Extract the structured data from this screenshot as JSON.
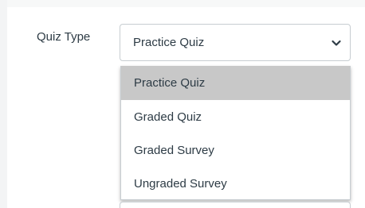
{
  "form": {
    "quiz_type_label": "Quiz Type",
    "quiz_type_value": "Practice Quiz",
    "options": [
      {
        "label": "Practice Quiz",
        "highlighted": true
      },
      {
        "label": "Graded Quiz",
        "highlighted": false
      },
      {
        "label": "Graded Survey",
        "highlighted": false
      },
      {
        "label": "Ungraded Survey",
        "highlighted": false
      }
    ]
  },
  "icons": {
    "dropdown_arrow": "chevron-down-icon"
  },
  "colors": {
    "text": "#2d3b45",
    "border": "#c7cdd1",
    "highlight": "#c8c8c8"
  }
}
